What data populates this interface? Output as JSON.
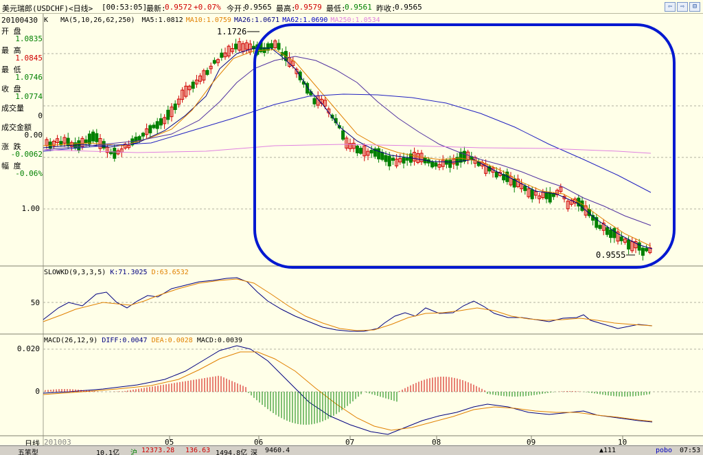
{
  "title_bar": {
    "symbol": "美元瑞郎(USDCHF)<日线>",
    "time": "[00:53:05]",
    "latest_label": "最新:",
    "latest_value": "0.9572",
    "change": "+0.07%",
    "open_label": "今开:",
    "open_value": "0.9565",
    "high_label": "最高:",
    "high_value": "0.9579",
    "low_label": "最低:",
    "low_value": "0.9561",
    "prevclose_label": "昨收:",
    "prevclose_value": "0.9565",
    "controls": [
      "⇦",
      "⇨",
      "⊟"
    ]
  },
  "info_panel": {
    "date": "20100430",
    "k_label": "K",
    "rows": [
      {
        "label": "开  盘",
        "value": "1.0835",
        "color": "#008000"
      },
      {
        "label": "最  高",
        "value": "1.0845",
        "color": "#D00000"
      },
      {
        "label": "最  低",
        "value": "1.0746",
        "color": "#008000"
      },
      {
        "label": "收  盘",
        "value": "1.0774",
        "color": "#008000"
      },
      {
        "label": "成交量",
        "value": "0",
        "color": "#000000"
      },
      {
        "label": "成交金额",
        "value": "0.00",
        "color": "#000000"
      },
      {
        "label": "涨  跌",
        "value": "-0.0062",
        "color": "#008000"
      },
      {
        "label": "幅  度",
        "value": "-0.06%",
        "color": "#008000"
      }
    ]
  },
  "main_legend": {
    "header": "MA(5,10,26,62,250)",
    "items": [
      {
        "text": "MA5:1.0812",
        "color": "#000000"
      },
      {
        "text": "MA10:1.0759",
        "color": "#E08000"
      },
      {
        "text": "MA26:1.0671",
        "color": "#000080"
      },
      {
        "text": "MA62:1.0690",
        "color": "#0000C0"
      },
      {
        "text": "MA250:1.0534",
        "color": "#E080E0"
      }
    ]
  },
  "main_scale": {
    "label_100": "1.00"
  },
  "annotations": {
    "high_mark": "1.1726",
    "low_mark": "0.9555"
  },
  "kd_legend": {
    "header": "SLOWKD(9,3,3,5)",
    "k": "K:71.3025",
    "d": "D:63.6532",
    "k_color": "#000080",
    "d_color": "#E08000"
  },
  "kd_scale": {
    "label_50": "50"
  },
  "macd_legend": {
    "header": "MACD(26,12,9)",
    "diff": "DIFF:0.0047",
    "dea": "DEA:0.0028",
    "macd": "MACD:0.0039"
  },
  "macd_scale": {
    "label_top": "0.020",
    "label_zero": "0"
  },
  "x_axis": {
    "period_label": "日线",
    "start": "201003",
    "months": [
      "05",
      "06",
      "07",
      "08",
      "09",
      "10"
    ]
  },
  "status_bar": {
    "items": [
      "五笔型",
      "10.1亿",
      "沪",
      "12373.28",
      "136.63",
      "1494.8亿",
      "深",
      "9460.4",
      "▲111",
      "pobo",
      "07:53"
    ]
  },
  "colors": {
    "background": "#FFFFE8",
    "up": "#D00000",
    "down": "#008000",
    "highlight_frame": "#0018D0"
  }
}
